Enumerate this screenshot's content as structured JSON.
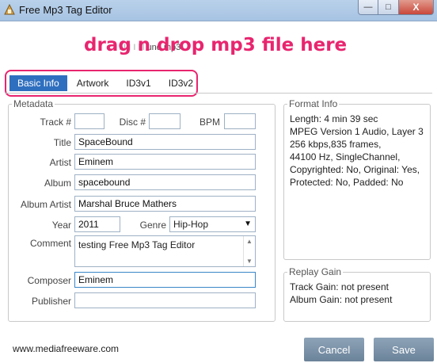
{
  "window": {
    "title": "Free Mp3 Tag Editor",
    "close_label": "X"
  },
  "drop": {
    "overlay": "drag n drop mp3 file here",
    "filename_fragment": "und.mp3"
  },
  "tabs": [
    {
      "label": "Basic Info",
      "active": true
    },
    {
      "label": "Artwork"
    },
    {
      "label": "ID3v1"
    },
    {
      "label": "ID3v2"
    }
  ],
  "metadata": {
    "legend": "Metadata",
    "track_label": "Track #",
    "track_value": "",
    "disc_label": "Disc #",
    "disc_value": "",
    "bpm_label": "BPM",
    "bpm_value": "",
    "title_label": "Title",
    "title_value": "SpaceBound",
    "artist_label": "Artist",
    "artist_value": "Eminem",
    "album_label": "Album",
    "album_value": "spacebound",
    "album_artist_label": "Album Artist",
    "album_artist_value": "Marshal Bruce Mathers",
    "year_label": "Year",
    "year_value": "2011",
    "genre_label": "Genre",
    "genre_value": "Hip-Hop",
    "comment_label": "Comment",
    "comment_value": "testing Free Mp3 Tag Editor",
    "composer_label": "Composer",
    "composer_value": "Eminem",
    "publisher_label": "Publisher",
    "publisher_value": ""
  },
  "format_info": {
    "legend": "Format Info",
    "lines": [
      "Length: 4 min 39 sec",
      "MPEG Version 1 Audio, Layer 3",
      "256 kbps,835 frames,",
      "44100 Hz, SingleChannel,",
      "Copyrighted: No, Original: Yes,",
      "Protected: No, Padded: No"
    ]
  },
  "replay_gain": {
    "legend": "Replay Gain",
    "track_gain": "Track Gain: not present",
    "album_gain": "Album Gain: not present"
  },
  "footer": {
    "website": "www.mediafreeware.com",
    "cancel_label": "Cancel",
    "save_label": "Save"
  },
  "colors": {
    "accent": "#2f6fbf",
    "highlight": "#e8256f",
    "button": "#7890a6"
  }
}
